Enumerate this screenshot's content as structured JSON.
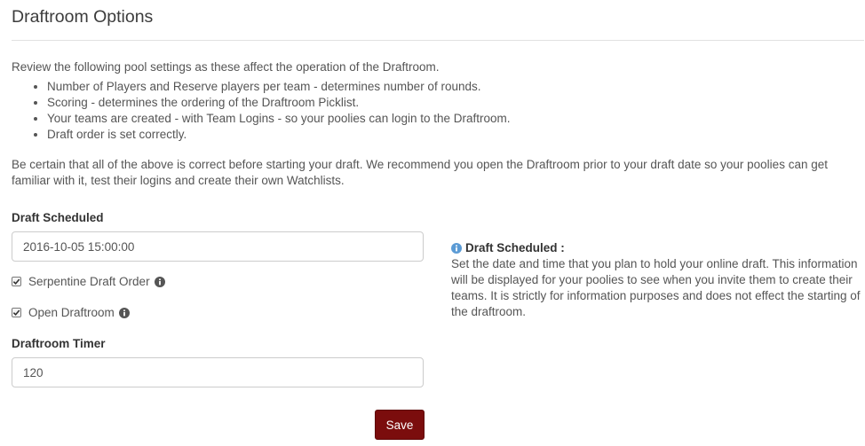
{
  "page": {
    "title": "Draftroom Options",
    "intro": "Review the following pool settings as these affect the operation of the Draftroom.",
    "bullets": [
      "Number of Players and Reserve players per team - determines number of rounds.",
      "Scoring - determines the ordering of the Draftroom Picklist.",
      "Your teams are created - with Team Logins - so your poolies can login to the Draftroom.",
      "Draft order is set correctly."
    ],
    "note": "Be certain that all of the above is correct before starting your draft. We recommend you open the Draftroom prior to your draft date so your poolies can get familiar with it, test their logins and create their own Watchlists."
  },
  "form": {
    "draft_scheduled_label": "Draft Scheduled",
    "draft_scheduled_value": "2016-10-05 15:00:00",
    "serpentine_label": "Serpentine Draft Order",
    "serpentine_checked": true,
    "open_draftroom_label": "Open Draftroom",
    "open_draftroom_checked": true,
    "timer_label": "Draftroom Timer",
    "timer_value": "120",
    "save_label": "Save"
  },
  "help": {
    "heading": "Draft Scheduled :",
    "body": "Set the date and time that you plan to hold your online draft. This information will be displayed for your poolies to see when you invite them to create their teams. It is strictly for information purposes and does not effect the starting of the draftroom."
  },
  "colors": {
    "accent": "#7b0d0d",
    "info_blue": "#5b9bd5",
    "info_gray": "#555555"
  },
  "icons": {
    "info_gray": "info-circle-icon",
    "info_blue": "info-circle-icon",
    "checkbox": "checkmark-icon"
  }
}
